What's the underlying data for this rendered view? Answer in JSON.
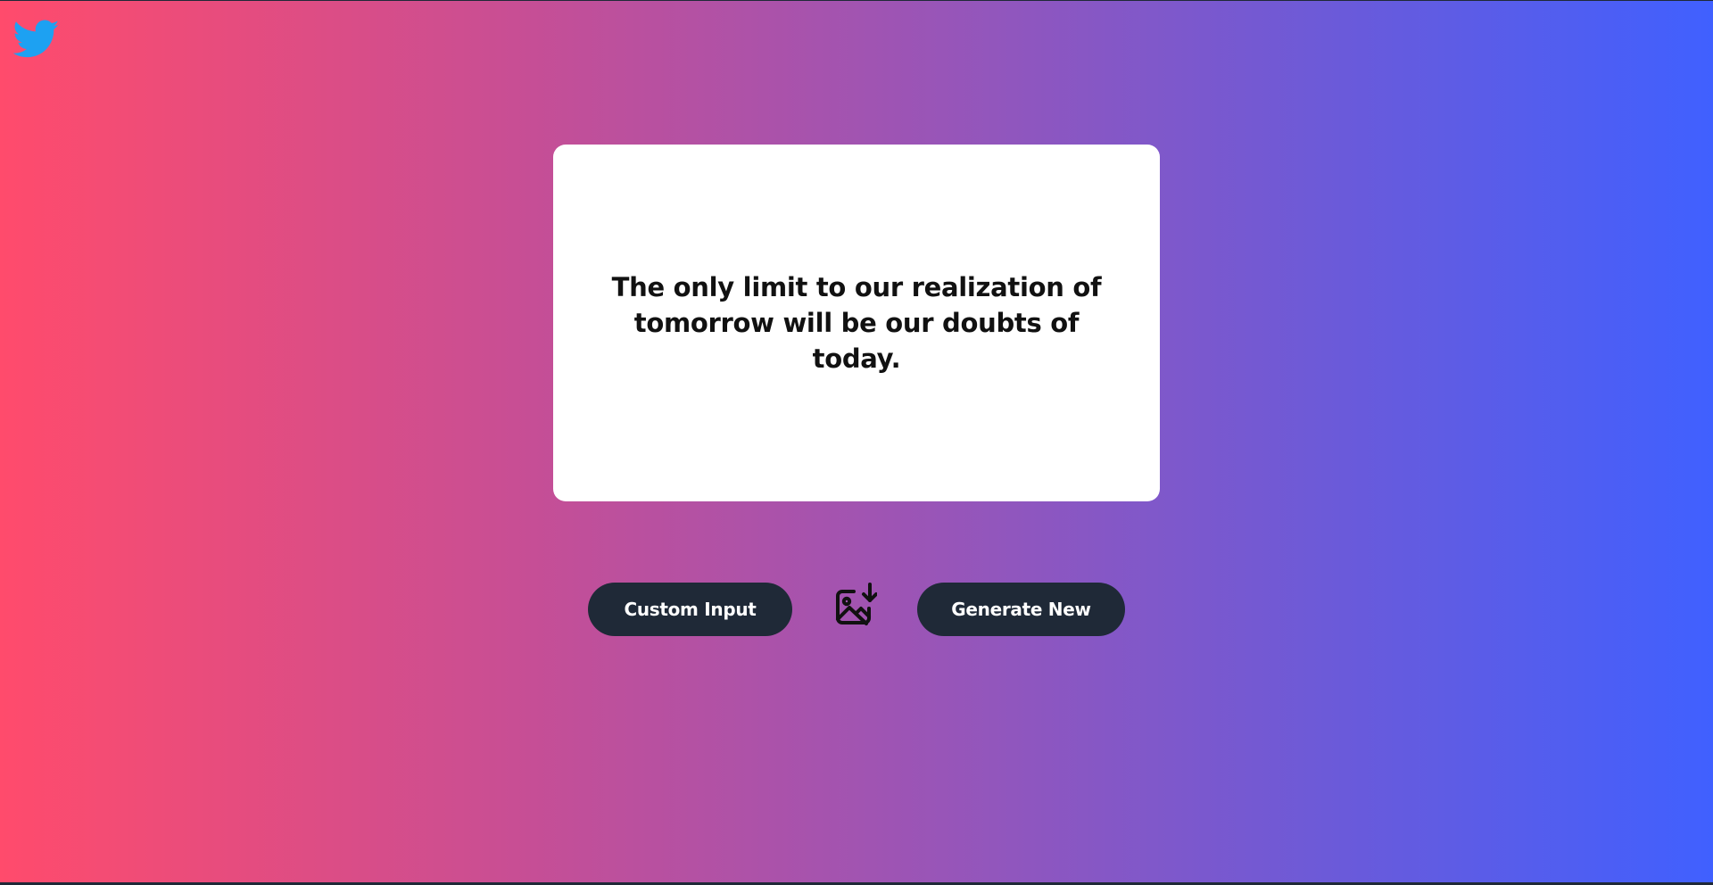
{
  "icons": {
    "twitter": "twitter-bird-icon",
    "download": "image-download-icon"
  },
  "colors": {
    "gradient_start": "#ff4b6c",
    "gradient_end": "#4060ff",
    "twitter_blue": "#1da1f2",
    "button_bg": "#1f2937",
    "button_text": "#ffffff",
    "card_bg": "#ffffff",
    "quote_text": "#111111"
  },
  "quote": {
    "line1": "The only limit to our realization of",
    "line2": "tomorrow will be our doubts of today."
  },
  "actions": {
    "custom_input_label": "Custom Input",
    "generate_new_label": "Generate New"
  }
}
